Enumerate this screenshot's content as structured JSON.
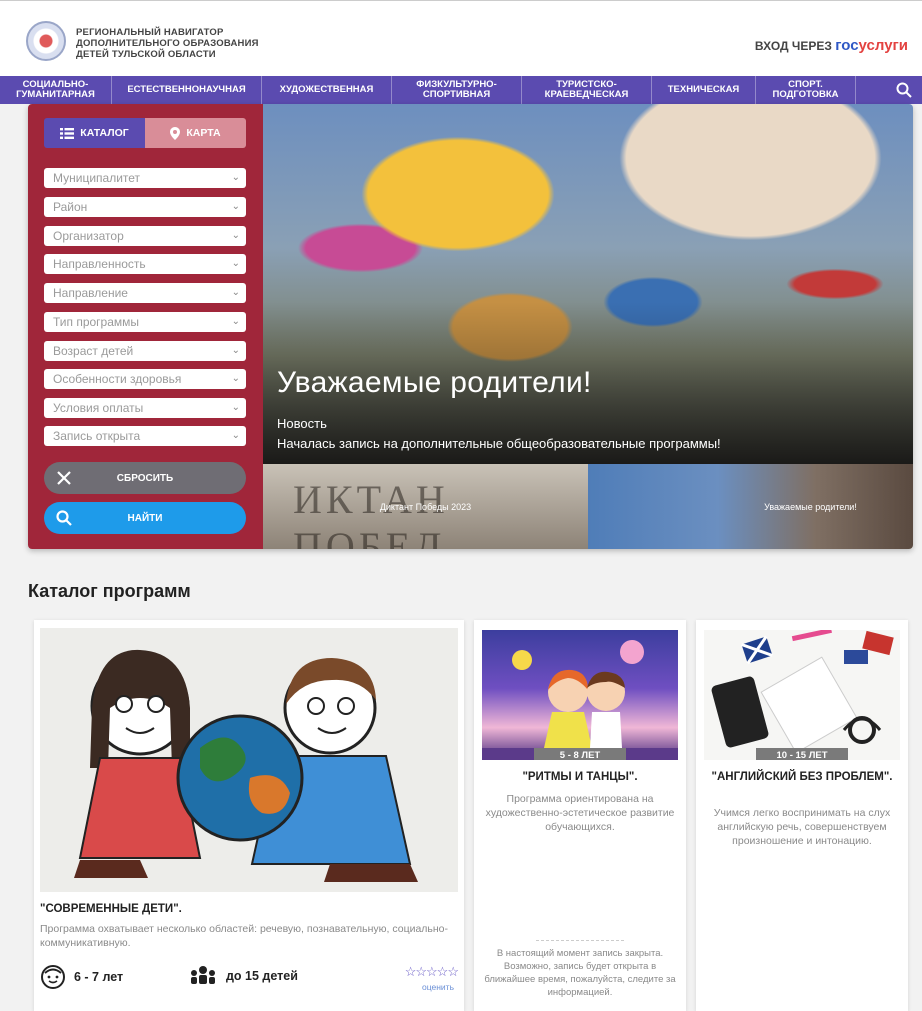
{
  "header": {
    "org_lines": [
      "РЕГИОНАЛЬНЫЙ НАВИГАТОР",
      "ДОПОЛНИТЕЛЬНОГО ОБРАЗОВАНИЯ",
      "ДЕТЕЙ ТУЛЬСКОЙ ОБЛАСТИ"
    ],
    "login_prefix": "ВХОД ЧЕРЕЗ",
    "login_gos": "гос",
    "login_uslugi": "услуги"
  },
  "nav": {
    "items": [
      {
        "line1": "СОЦИАЛЬНО-",
        "line2": "ГУМАНИТАРНАЯ"
      },
      {
        "line1": "ЕСТЕСТВЕННОНАУЧНАЯ",
        "line2": ""
      },
      {
        "line1": "ХУДОЖЕСТВЕННАЯ",
        "line2": ""
      },
      {
        "line1": "ФИЗКУЛЬТУРНО-",
        "line2": "СПОРТИВНАЯ"
      },
      {
        "line1": "ТУРИСТСКО-",
        "line2": "КРАЕВЕДЧЕСКАЯ"
      },
      {
        "line1": "ТЕХНИЧЕСКАЯ",
        "line2": ""
      },
      {
        "line1": "СПОРТ.",
        "line2": "ПОДГОТОВКА"
      }
    ]
  },
  "filter": {
    "tab_catalog": "КАТАЛОГ",
    "tab_map": "КАРТА",
    "selects": [
      "Муниципалитет",
      "Район",
      "Организатор",
      "Направленность",
      "Направление",
      "Тип программы",
      "Возраст детей",
      "Особенности здоровья",
      "Условия оплаты",
      "Запись открыта"
    ],
    "reset_label": "СБРОСИТЬ",
    "find_label": "НАЙТИ"
  },
  "slider": {
    "title": "Уважаемые родители!",
    "category": "Новость",
    "text": "Началась запись на дополнительные общеобразовательные программы!",
    "thumbs": [
      "Диктант Победы 2023",
      "Уважаемые родители!"
    ],
    "thumb1_bg_text": "ИКТАН ПОБЕД"
  },
  "catalog": {
    "title": "Каталог программ",
    "cards": [
      {
        "title": "\"СОВРЕМЕННЫЕ ДЕТИ\".",
        "desc": "Программа охватывает несколько областей: речевую, познавательную, социально- коммуникативную.",
        "age": "6 - 7 лет",
        "group": "до 15 детей",
        "stars": "☆☆☆☆☆",
        "rate_label": "оценить"
      },
      {
        "age_badge": "5 - 8 ЛЕТ",
        "title": "\"РИТМЫ И ТАНЦЫ\".",
        "desc": "Программа ориентирована на художественно-эстетическое развитие обучающихся.",
        "closed": "В настоящий момент запись закрыта. Возможно, запись будет открыта в ближайшее время, пожалуйста, следите за информацией."
      },
      {
        "age_badge": "10 - 15 ЛЕТ",
        "title": "\"АНГЛИЙСКИЙ БЕЗ ПРОБЛЕМ\".",
        "desc": "Учимся легко воспринимать на слух английскую речь, совершенствуем произношение и интонацию."
      }
    ]
  },
  "colors": {
    "nav": "#5b4bb0",
    "filter_panel": "#a0263a",
    "find_button": "#1e9bea",
    "reset_button": "#6f6d74",
    "gos": "#2f58c5",
    "uslugi": "#e34240"
  }
}
